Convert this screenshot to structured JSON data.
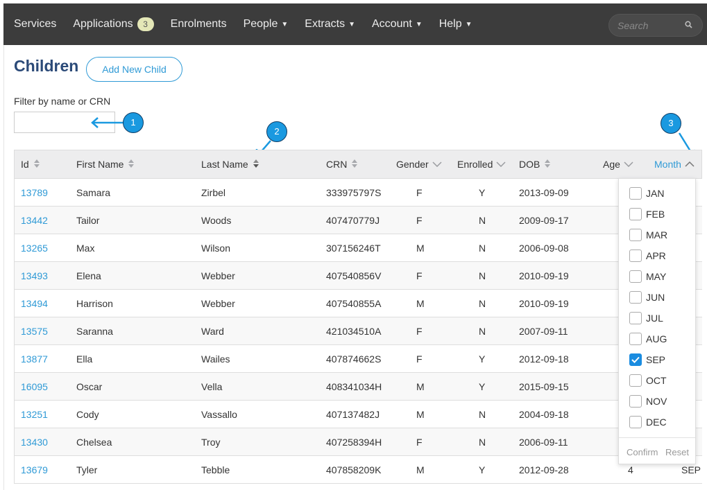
{
  "nav": {
    "items": [
      {
        "label": "Services",
        "caret": false
      },
      {
        "label": "Applications",
        "caret": false,
        "badge": "3"
      },
      {
        "label": "Enrolments",
        "caret": false
      },
      {
        "label": "People",
        "caret": true
      },
      {
        "label": "Extracts",
        "caret": true
      },
      {
        "label": "Account",
        "caret": true
      },
      {
        "label": "Help",
        "caret": true
      }
    ],
    "search_placeholder": "Search"
  },
  "page": {
    "title": "Children",
    "add_button": "Add New Child",
    "filter_label": "Filter by name or CRN",
    "filter_value": ""
  },
  "annotations": [
    "1",
    "2",
    "3"
  ],
  "table": {
    "columns": [
      "Id",
      "First Name",
      "Last Name",
      "CRN",
      "Gender",
      "Enrolled",
      "DOB",
      "Age",
      "Month"
    ],
    "rows": [
      [
        "13789",
        "Samara",
        "Zirbel",
        "333975797S",
        "F",
        "Y",
        "2013-09-09",
        "",
        ""
      ],
      [
        "13442",
        "Tailor",
        "Woods",
        "407470779J",
        "F",
        "N",
        "2009-09-17",
        "",
        ""
      ],
      [
        "13265",
        "Max",
        "Wilson",
        "307156246T",
        "M",
        "N",
        "2006-09-08",
        "",
        ""
      ],
      [
        "13493",
        "Elena",
        "Webber",
        "407540856V",
        "F",
        "N",
        "2010-09-19",
        "",
        ""
      ],
      [
        "13494",
        "Harrison",
        "Webber",
        "407540855A",
        "M",
        "N",
        "2010-09-19",
        "",
        ""
      ],
      [
        "13575",
        "Saranna",
        "Ward",
        "421034510A",
        "F",
        "N",
        "2007-09-11",
        "",
        ""
      ],
      [
        "13877",
        "Ella",
        "Wailes",
        "407874662S",
        "F",
        "Y",
        "2012-09-18",
        "",
        ""
      ],
      [
        "16095",
        "Oscar",
        "Vella",
        "408341034H",
        "M",
        "Y",
        "2015-09-15",
        "",
        ""
      ],
      [
        "13251",
        "Cody",
        "Vassallo",
        "407137482J",
        "M",
        "N",
        "2004-09-18",
        "",
        ""
      ],
      [
        "13430",
        "Chelsea",
        "Troy",
        "407258394H",
        "F",
        "N",
        "2006-09-11",
        "",
        ""
      ],
      [
        "13679",
        "Tyler",
        "Tebble",
        "407858209K",
        "M",
        "Y",
        "2012-09-28",
        "4",
        "SEP"
      ]
    ]
  },
  "month_filter": {
    "options": [
      {
        "label": "JAN",
        "checked": false
      },
      {
        "label": "FEB",
        "checked": false
      },
      {
        "label": "MAR",
        "checked": false
      },
      {
        "label": "APR",
        "checked": false
      },
      {
        "label": "MAY",
        "checked": false
      },
      {
        "label": "JUN",
        "checked": false
      },
      {
        "label": "JUL",
        "checked": false
      },
      {
        "label": "AUG",
        "checked": false
      },
      {
        "label": "SEP",
        "checked": true
      },
      {
        "label": "OCT",
        "checked": false
      },
      {
        "label": "NOV",
        "checked": false
      },
      {
        "label": "DEC",
        "checked": false
      }
    ],
    "confirm_label": "Confirm",
    "reset_label": "Reset"
  },
  "colors": {
    "navbar": "#3c3c3c",
    "accent": "#2f9ad6",
    "title": "#2b4a78",
    "annotation": "#1a99e0"
  }
}
